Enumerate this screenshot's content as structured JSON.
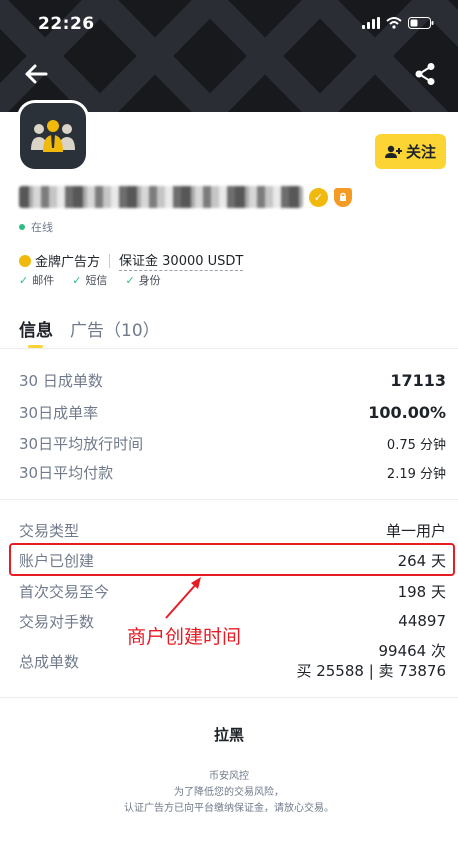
{
  "status_bar": {
    "time": "22:26"
  },
  "icons": {
    "back": "arrow-left-icon",
    "share": "share-icon",
    "follow": "user-plus-icon",
    "verified": "gold-verified-icon",
    "shield": "shield-badge-icon",
    "check": "check-icon"
  },
  "colors": {
    "accent": "#fcd535",
    "highlight_red": "#e51c23",
    "online_green": "#2ebd85",
    "header_bg": "#17191d"
  },
  "profile": {
    "follow_label": "关注",
    "online_status": "在线",
    "merchant_type": "金牌广告方",
    "deposit": "保证金 30000 USDT",
    "verifications": [
      "邮件",
      "短信",
      "身份"
    ]
  },
  "tabs": [
    {
      "label": "信息",
      "active": true
    },
    {
      "label": "广告（10）",
      "active": false
    }
  ],
  "stats_30d": [
    {
      "label": "30 日成单数",
      "value": "17113"
    },
    {
      "label": "30日成单率",
      "value": "100.00%"
    },
    {
      "label": "30日平均放行时间",
      "value": "0.75 分钟"
    },
    {
      "label": "30日平均付款",
      "value": "2.19 分钟"
    }
  ],
  "account_info": [
    {
      "label": "交易类型",
      "value": "单一用户"
    },
    {
      "label": "账户已创建",
      "value": "264 天"
    },
    {
      "label": "首次交易至今",
      "value": "198 天"
    },
    {
      "label": "交易对手数",
      "value": "44897"
    }
  ],
  "total_orders": {
    "label": "总成单数",
    "value_line1": "99464 次",
    "value_line2": "买 25588 | 卖 73876"
  },
  "annotation": {
    "text": "商户创建时间"
  },
  "block_label": "拉黑",
  "footer": {
    "title": "币安风控",
    "line1": "为了降低您的交易风险，",
    "line2": "认证广告方已向平台缴纳保证金，请放心交易。"
  }
}
